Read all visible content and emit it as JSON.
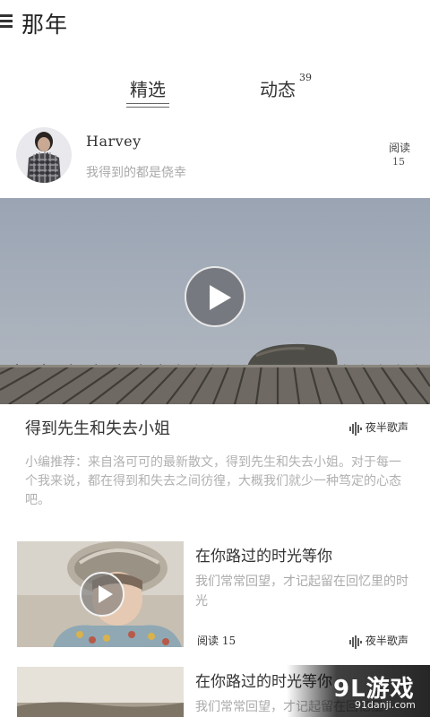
{
  "header": {
    "title": "那年",
    "menu_icon": "hamburger-icon"
  },
  "tabs": [
    {
      "label": "精选",
      "selected": true
    },
    {
      "label": "动态",
      "badge": "39"
    }
  ],
  "author": {
    "name": "Harvey",
    "motto": "我得到的都是侥幸",
    "read_label": "阅读",
    "read_count": "15"
  },
  "featured": {
    "title": "得到先生和失去小姐",
    "audio_label": "夜半歌声",
    "summary": "小编推荐：来自洛可可的最新散文，得到先生和失去小姐。对于每一个我来说，都在得到和失去之间彷徨，大概我们就少一种笃定的心态吧。"
  },
  "list": [
    {
      "title": "在你路过的时光等你",
      "summary": "我们常常回望，才记起留在回忆里的时光",
      "reads": "阅读 15",
      "audio_label": "夜半歌声"
    },
    {
      "title": "在你路过的时光等你",
      "summary": "我们常常回望，才记起留在回忆里"
    }
  ],
  "watermark": {
    "logo": "9L游戏",
    "url": "91danji.com"
  },
  "colors": {
    "accent_text": "#333333",
    "muted_text": "#aaaaaa"
  }
}
